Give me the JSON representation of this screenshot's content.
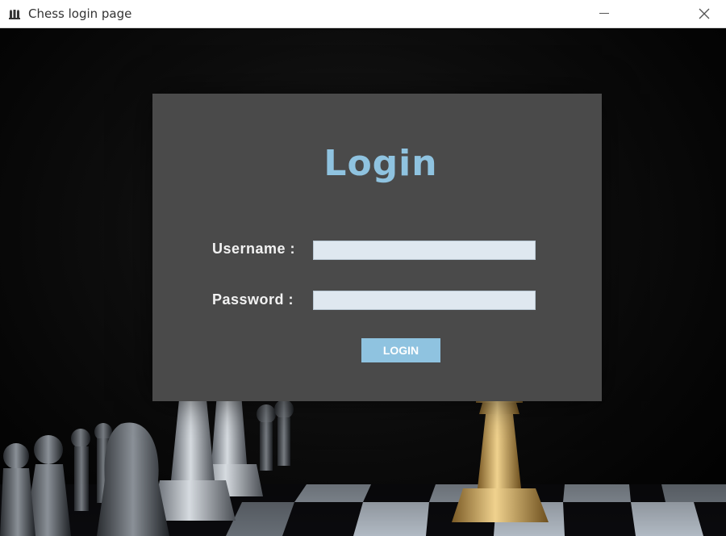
{
  "window": {
    "title": "Chess login page",
    "app_icon": "chess-pieces-icon",
    "controls": [
      "minimize-icon",
      "close-icon"
    ]
  },
  "login": {
    "title": "Login",
    "username_label": "Username :",
    "username_value": "",
    "password_label": "Password :",
    "password_value": "",
    "button_label": "LOGIN"
  },
  "background": {
    "description": "chess pieces on a chessboard",
    "colors": {
      "accent": "#8fc3e0",
      "panel": "#4a4a4a",
      "input": "#dfe8f0",
      "background": "#000000",
      "gold_king": "#c9a25a"
    }
  }
}
